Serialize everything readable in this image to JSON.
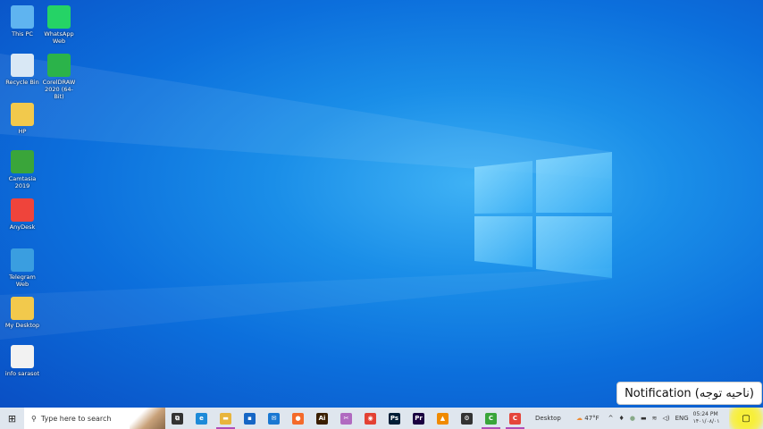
{
  "desktop_icons": [
    {
      "label": "This PC",
      "icon": "computer-icon",
      "color": "#5fb4f0"
    },
    {
      "label": "WhatsApp Web",
      "icon": "whatsapp-icon",
      "color": "#25d366"
    },
    {
      "label": "Recycle Bin",
      "icon": "recycle-bin-icon",
      "color": "#d9e8f5"
    },
    {
      "label": "CorelDRAW 2020 (64-Bit)",
      "icon": "coreldraw-icon",
      "color": "#2bb34a"
    },
    {
      "label": "HP",
      "icon": "user-folder-icon",
      "color": "#f2c94c"
    },
    {
      "label": "Camtasia 2019",
      "icon": "camtasia-icon",
      "color": "#3aa53a"
    },
    {
      "label": "AnyDesk",
      "icon": "anydesk-icon",
      "color": "#ef443b"
    },
    {
      "label": "Telegram Web",
      "icon": "telegram-icon",
      "color": "#3a9ee0"
    },
    {
      "label": "My Desktop",
      "icon": "folder-icon",
      "color": "#f2c94c"
    },
    {
      "label": "info sarasot",
      "icon": "text-file-icon",
      "color": "#f2f2f2"
    }
  ],
  "taskbar": {
    "search_placeholder": "Type here to search",
    "apps": [
      {
        "name": "task-view",
        "glyph": "⧉",
        "color": "#333"
      },
      {
        "name": "edge",
        "glyph": "e",
        "color": "#1d8ad8"
      },
      {
        "name": "file-explorer",
        "glyph": "▬",
        "color": "#e8b53c"
      },
      {
        "name": "store",
        "glyph": "▪",
        "color": "#1666c5"
      },
      {
        "name": "mail",
        "glyph": "✉",
        "color": "#1a78d2"
      },
      {
        "name": "firefox",
        "glyph": "●",
        "color": "#f46a2a"
      },
      {
        "name": "illustrator",
        "glyph": "Ai",
        "color": "#3a1f00"
      },
      {
        "name": "snipping",
        "glyph": "✂",
        "color": "#b06ac0"
      },
      {
        "name": "chrome",
        "glyph": "◉",
        "color": "#e34133"
      },
      {
        "name": "photoshop",
        "glyph": "Ps",
        "color": "#001e36"
      },
      {
        "name": "premiere",
        "glyph": "Pr",
        "color": "#1a0040"
      },
      {
        "name": "vlc",
        "glyph": "▲",
        "color": "#f08a00"
      },
      {
        "name": "settings",
        "glyph": "⚙",
        "color": "#333"
      },
      {
        "name": "camtasia",
        "glyph": "C",
        "color": "#3aa53a"
      },
      {
        "name": "camtasia-recorder",
        "glyph": "C",
        "color": "#e5463b"
      }
    ],
    "toolbar_label": "Desktop",
    "weather": "47°F",
    "language": "ENG",
    "time": "05:24 PM",
    "date": "۱۴۰۱/۰۸/۰۱"
  },
  "tooltip": "Notification (ناحیه توجه)"
}
